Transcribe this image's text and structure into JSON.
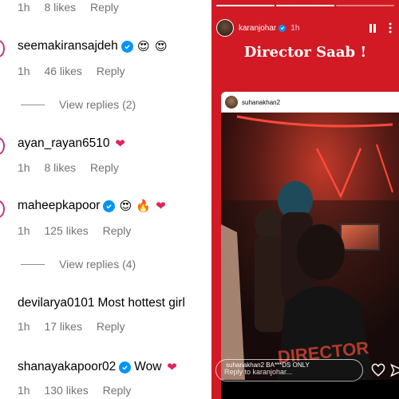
{
  "comments": {
    "top_meta": {
      "time": "1h",
      "likes": "8 likes",
      "reply": "Reply"
    },
    "items": [
      {
        "username": "seemakiransajdeh",
        "verified": true,
        "text": "",
        "emojis": [
          "smiling-hearts-emoji",
          "smiling-hearts-emoji"
        ],
        "time": "1h",
        "likes": "46 likes",
        "reply": "Reply",
        "view_replies": "View replies (2)"
      },
      {
        "username": "ayan_rayan6510",
        "verified": false,
        "text": "",
        "emojis": [
          "red-heart-emoji"
        ],
        "time": "1h",
        "likes": "8 likes",
        "reply": "Reply",
        "view_replies": ""
      },
      {
        "username": "maheepkapoor",
        "verified": true,
        "text": "",
        "emojis": [
          "smiling-hearts-emoji",
          "fire-emoji",
          "red-heart-emoji"
        ],
        "time": "1h",
        "likes": "125 likes",
        "reply": "Reply",
        "view_replies": "View replies (4)"
      },
      {
        "username": "devilarya0101",
        "verified": false,
        "text": "Most hottest girl",
        "emojis": [],
        "time": "1h",
        "likes": "17 likes",
        "reply": "Reply",
        "view_replies": ""
      },
      {
        "username": "shanayakapoor02",
        "verified": true,
        "text": "Wow",
        "emojis": [
          "red-heart-emoji"
        ],
        "time": "1h",
        "likes": "130 likes",
        "reply": "Reply",
        "view_replies": ""
      }
    ]
  },
  "story": {
    "username": "karanjohar",
    "time": "1h",
    "title": "Director Saab !",
    "shared_post_username": "suhanakhan2",
    "scene_text": "DIRECTOR",
    "caption": "suhanakhan2 BA***DS ONLY",
    "reply_placeholder": "Reply to karanjohar...",
    "accent_color": "#d11a24",
    "verified_color": "#0095f6"
  }
}
